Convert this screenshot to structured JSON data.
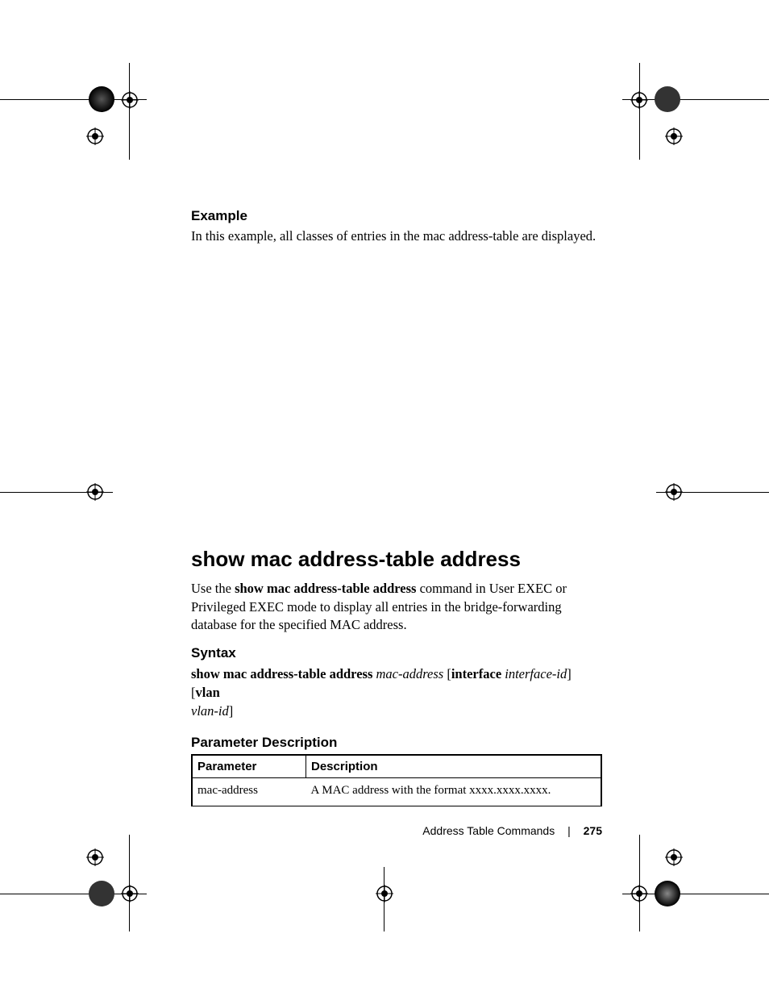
{
  "sections": {
    "example": {
      "heading": "Example",
      "body": "In this example, all classes of entries in the mac address-table are displayed."
    },
    "title": "show mac address-table address",
    "intro": {
      "pre": "Use the ",
      "cmd": "show mac address-table address",
      "post": " command in User EXEC or Privileged EXEC mode to display all entries in the bridge-forwarding database for the specified MAC address."
    },
    "syntax": {
      "heading": "Syntax",
      "cmd": "show mac address-table address",
      "arg1": "mac-address",
      "lb1": " [",
      "kw1": "interface",
      "sp1": " ",
      "arg2": "interface-id",
      "rb1": "] [",
      "kw2": "vlan",
      "arg3": "vlan-id",
      "rb2": "]"
    },
    "paramdesc": {
      "heading": "Parameter Description",
      "headers": {
        "p": "Parameter",
        "d": "Description"
      },
      "rows": [
        {
          "p": "mac-address",
          "d": "A MAC address with the format xxxx.xxxx.xxxx."
        }
      ]
    }
  },
  "footer": {
    "section": "Address Table Commands",
    "page": "275"
  }
}
